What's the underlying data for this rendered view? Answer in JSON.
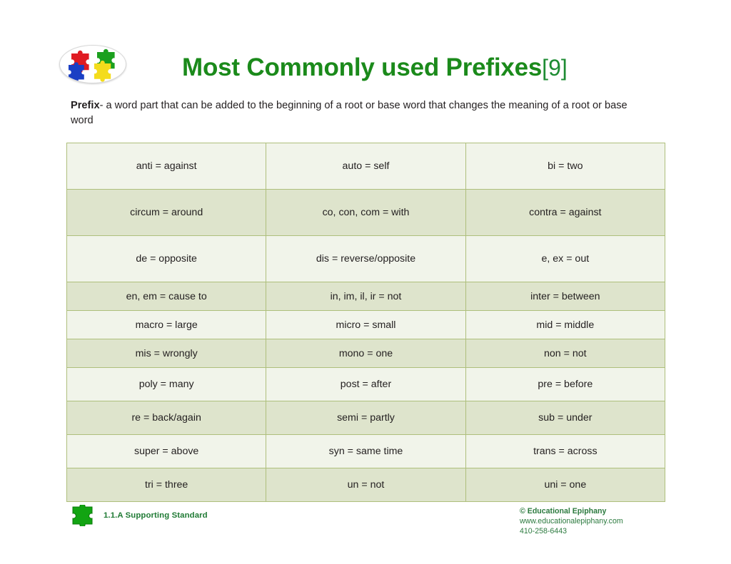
{
  "page": {
    "background_color": "#ffffff",
    "accent_green": "#1b8a1b",
    "table_border_color": "#aebf7c",
    "row_light_color": "#f1f4ea",
    "row_dark_color": "#dee4cc"
  },
  "header": {
    "logo_name": "educational-epiphany-puzzle-logo",
    "logo_pieces": [
      {
        "name": "puzzle-piece-red",
        "color": "#e01b22"
      },
      {
        "name": "puzzle-piece-green",
        "color": "#1ba01e"
      },
      {
        "name": "puzzle-piece-blue",
        "color": "#1b3fc4"
      },
      {
        "name": "puzzle-piece-yellow",
        "color": "#f4dc1c"
      }
    ],
    "title_main": "Most Commonly used Prefixes",
    "title_suffix": "[9]"
  },
  "subtitle": {
    "lead": "Prefix",
    "rest": "- a word part that can be added to the beginning of a root or base word that changes the meaning of a root or base word"
  },
  "table": {
    "columns": 3,
    "rows": [
      {
        "shade": "light",
        "height": "tall",
        "cells": [
          "anti = against",
          "auto = self",
          "bi = two"
        ]
      },
      {
        "shade": "dark",
        "height": "tall",
        "cells": [
          "circum = around",
          "co, con, com = with",
          "contra = against"
        ]
      },
      {
        "shade": "light",
        "height": "tall",
        "cells": [
          "de = opposite",
          "dis = reverse/opposite",
          "e, ex = out"
        ]
      },
      {
        "shade": "dark",
        "height": "short",
        "cells": [
          "en, em = cause to",
          "in, im, il, ir = not",
          "inter = between"
        ]
      },
      {
        "shade": "light",
        "height": "short",
        "cells": [
          "macro = large",
          "micro = small",
          "mid = middle"
        ]
      },
      {
        "shade": "dark",
        "height": "short",
        "cells": [
          "mis = wrongly",
          "mono = one",
          "non = not"
        ]
      },
      {
        "shade": "light",
        "height": "mid",
        "cells": [
          "poly = many",
          "post = after",
          "pre = before"
        ]
      },
      {
        "shade": "dark",
        "height": "mid",
        "cells": [
          "re = back/again",
          "semi = partly",
          "sub = under"
        ]
      },
      {
        "shade": "light",
        "height": "mid",
        "cells": [
          "super = above",
          "syn = same time",
          "trans = across"
        ]
      },
      {
        "shade": "dark",
        "height": "mid",
        "cells": [
          "tri = three",
          "un = not",
          "uni = one"
        ]
      }
    ]
  },
  "footer": {
    "standard_icon_name": "green-puzzle-piece-icon",
    "standard_label": "1.1.A Supporting Standard",
    "copyright": "© Educational Epiphany",
    "website": "www.educationalepiphany.com",
    "phone": "410-258-6443"
  }
}
